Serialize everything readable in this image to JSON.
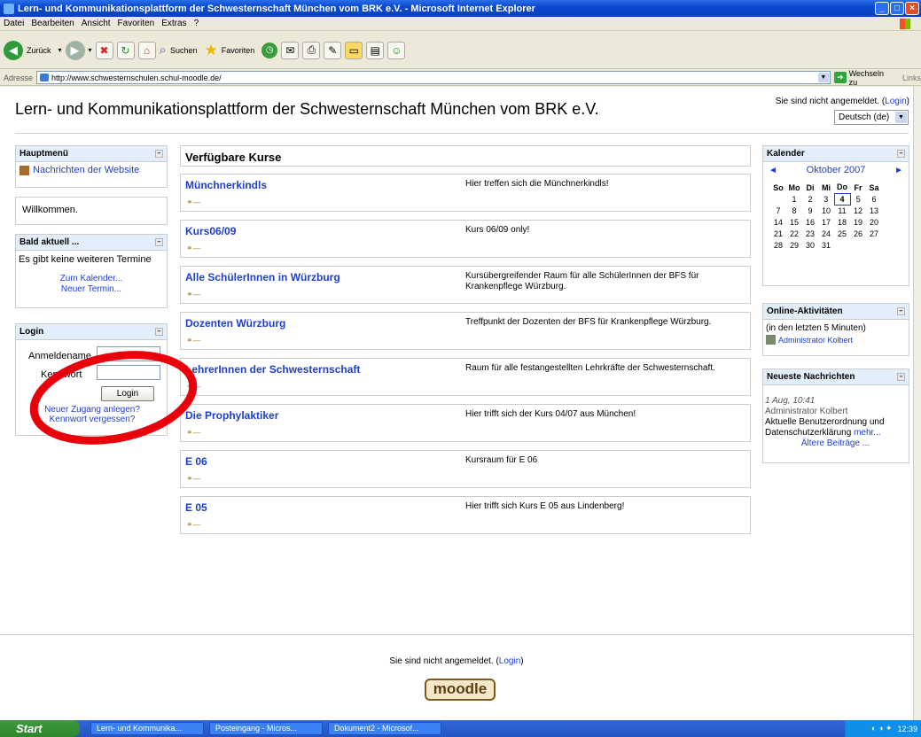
{
  "window": {
    "title": "Lern- und Kommunikationsplattform der Schwesternschaft München vom BRK e.V. - Microsoft Internet Explorer"
  },
  "menu": [
    "Datei",
    "Bearbeiten",
    "Ansicht",
    "Favoriten",
    "Extras",
    "?"
  ],
  "toolbar": {
    "back": "Zurück",
    "search": "Suchen",
    "favorites": "Favoriten"
  },
  "address": {
    "label": "Adresse",
    "url": "http://www.schwesternschulen.schul-moodle.de/",
    "go": "Wechseln zu",
    "links": "Links"
  },
  "page": {
    "title": "Lern- und Kommunikationsplattform der Schwesternschaft München vom BRK e.V.",
    "login_text": "Sie sind nicht angemeldet. (",
    "login_link": "Login",
    "login_close": ")",
    "language": "Deutsch (de)"
  },
  "blocks": {
    "mainmenu": {
      "title": "Hauptmenü",
      "news_link": "Nachrichten der Website"
    },
    "welcome": "Willkommen.",
    "upcoming": {
      "title": "Bald aktuell ...",
      "empty": "Es gibt keine weiteren Termine",
      "calendar_link": "Zum Kalender...",
      "new_event": "Neuer Termin..."
    },
    "login": {
      "title": "Login",
      "username_label": "Anmeldename",
      "password_label": "Kennwort",
      "button": "Login",
      "signup": "Neuer Zugang anlegen?",
      "forgot": "Kennwort vergessen?"
    }
  },
  "courses": {
    "title": "Verfügbare Kurse",
    "items": [
      {
        "name": "Münchnerkindls",
        "desc": "Hier treffen sich die Münchnerkindls!"
      },
      {
        "name": "Kurs06/09",
        "desc": "Kurs 06/09 only!"
      },
      {
        "name": "Alle SchülerInnen in Würzburg",
        "desc": "Kursübergreifender Raum für alle SchülerInnen der BFS für Krankenpflege Würzburg."
      },
      {
        "name": "Dozenten Würzburg",
        "desc": "Treffpunkt der Dozenten der BFS für Krankenpflege Würzburg."
      },
      {
        "name": "LehrerInnen der Schwesternschaft",
        "desc": "Raum für alle festangestellten Lehrkräfte der Schwesternschaft."
      },
      {
        "name": "Die Prophylaktiker",
        "desc": "Hier trifft sich der Kurs 04/07 aus München!"
      },
      {
        "name": "E 06",
        "desc": "Kursraum für E 06"
      },
      {
        "name": "E 05",
        "desc": "Hier trifft sich Kurs E 05 aus Lindenberg!"
      }
    ]
  },
  "calendar": {
    "title": "Kalender",
    "month": "Oktober 2007",
    "weekdays": [
      "So",
      "Mo",
      "Di",
      "Mi",
      "Do",
      "Fr",
      "Sa"
    ],
    "weeks": [
      [
        "",
        "1",
        "2",
        "3",
        "4",
        "5",
        "6"
      ],
      [
        "7",
        "8",
        "9",
        "10",
        "11",
        "12",
        "13"
      ],
      [
        "14",
        "15",
        "16",
        "17",
        "18",
        "19",
        "20"
      ],
      [
        "21",
        "22",
        "23",
        "24",
        "25",
        "26",
        "27"
      ],
      [
        "28",
        "29",
        "30",
        "31",
        "",
        "",
        ""
      ]
    ],
    "today": "4"
  },
  "online": {
    "title": "Online-Aktivitäten",
    "period": "(in den letzten 5 Minuten)",
    "user": "Administrator Kolbert"
  },
  "news": {
    "title": "Neueste Nachrichten",
    "date": "1 Aug, 10:41",
    "author": "Administrator Kolbert",
    "text": "Aktuelle Benutzerordnung und Datenschutzerklärung",
    "more": "mehr...",
    "older": "Ältere Beiträge ..."
  },
  "footer": {
    "login_text": "Sie sind nicht angemeldet. (",
    "login_link": "Login",
    "login_close": ")",
    "logo": "moodle"
  },
  "taskbar": {
    "start": "Start",
    "tasks": [
      "Lern- und Kommunika...",
      "Posteingang - Micros...",
      "Dokument2 - Microsof..."
    ],
    "clock": "12:39"
  },
  "colors": {
    "accent": "#1e3fcc",
    "block_header": "#e3eefb",
    "highlight_circle": "#e8000b"
  }
}
